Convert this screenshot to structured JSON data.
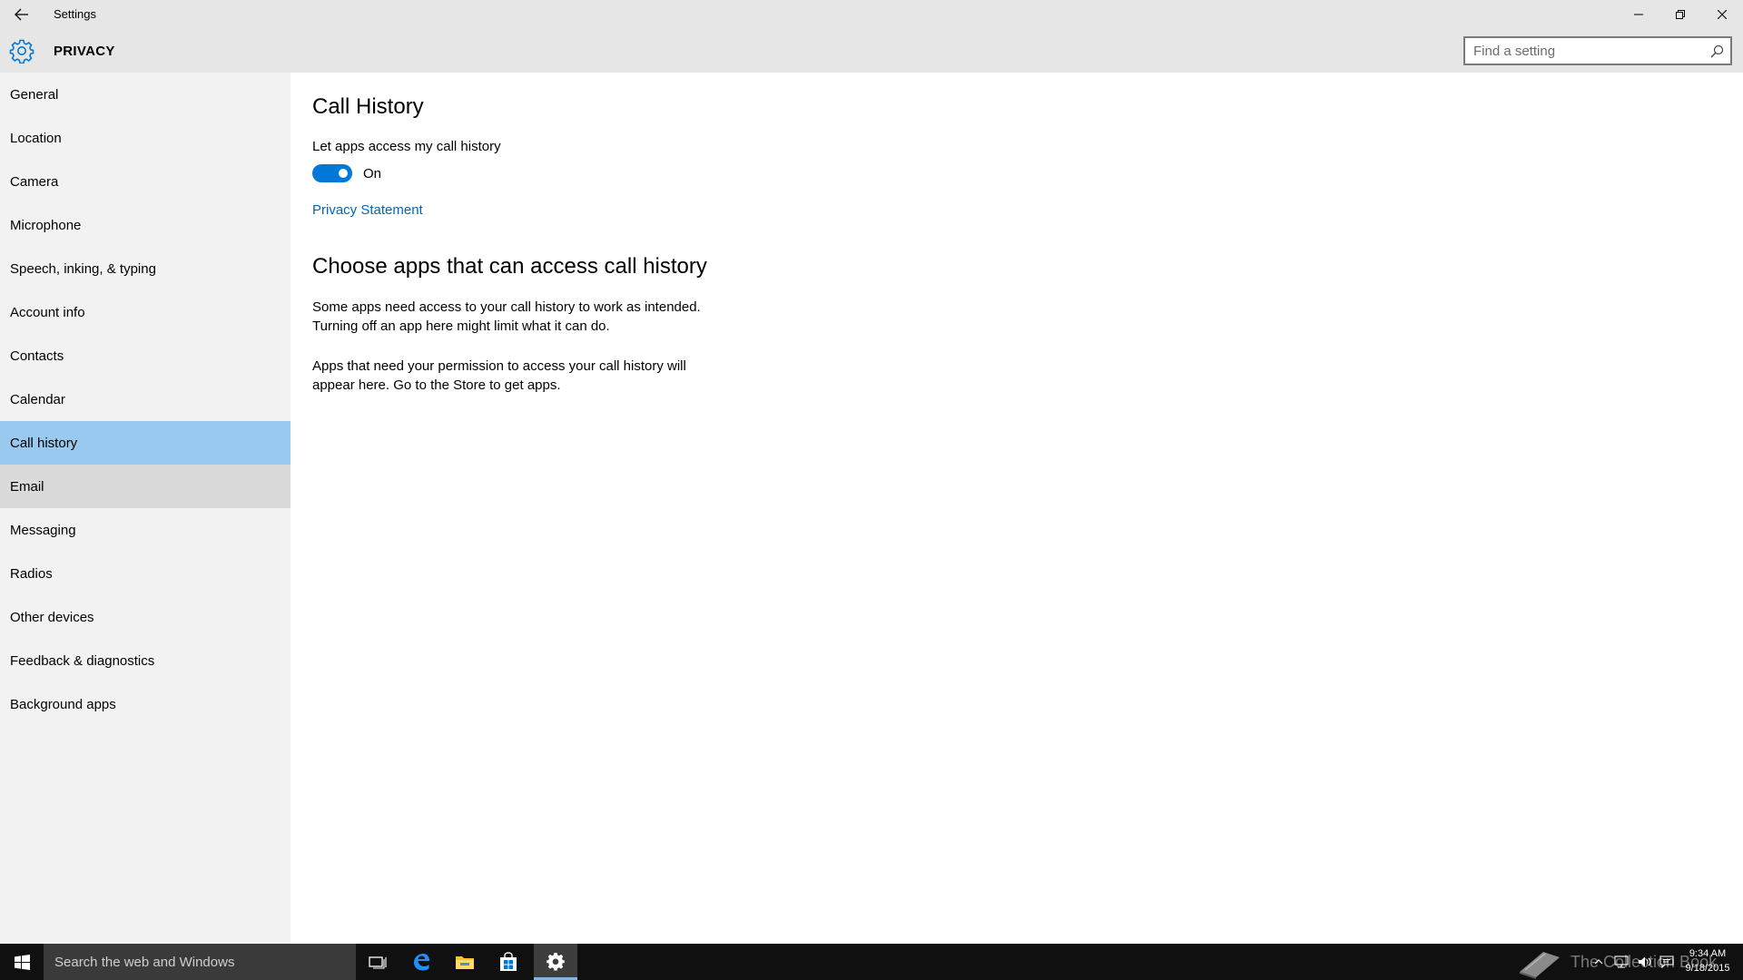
{
  "window": {
    "title": "Settings"
  },
  "header": {
    "section": "PRIVACY",
    "search_placeholder": "Find a setting"
  },
  "sidebar": {
    "items": [
      {
        "label": "General",
        "state": "normal"
      },
      {
        "label": "Location",
        "state": "normal"
      },
      {
        "label": "Camera",
        "state": "normal"
      },
      {
        "label": "Microphone",
        "state": "normal"
      },
      {
        "label": "Speech, inking, & typing",
        "state": "normal"
      },
      {
        "label": "Account info",
        "state": "normal"
      },
      {
        "label": "Contacts",
        "state": "normal"
      },
      {
        "label": "Calendar",
        "state": "normal"
      },
      {
        "label": "Call history",
        "state": "selected"
      },
      {
        "label": "Email",
        "state": "hover"
      },
      {
        "label": "Messaging",
        "state": "normal"
      },
      {
        "label": "Radios",
        "state": "normal"
      },
      {
        "label": "Other devices",
        "state": "normal"
      },
      {
        "label": "Feedback & diagnostics",
        "state": "normal"
      },
      {
        "label": "Background apps",
        "state": "normal"
      }
    ]
  },
  "main": {
    "title": "Call History",
    "toggle_label": "Let apps access my call history",
    "toggle_state": "On",
    "toggle_on": true,
    "privacy_link": "Privacy Statement",
    "choose_title": "Choose apps that can access call history",
    "paragraph1_line1": "Some apps need access to your call history to work as intended.",
    "paragraph1_line2": "Turning off an app here might limit what it can do.",
    "paragraph2_line1": "Apps that need your permission to access your call history will",
    "paragraph2_line2": "appear here. Go to the Store to get apps."
  },
  "taskbar": {
    "search_text": "Search the web and Windows",
    "watermark": "The Collection Book",
    "time": "9:34 AM",
    "date": "9/18/2015",
    "icons": [
      "task-view-icon",
      "edge-icon",
      "file-explorer-icon",
      "store-icon",
      "settings-icon"
    ]
  },
  "colors": {
    "accent": "#0078d7",
    "selected_bg": "#99c9ef",
    "hover_bg": "#dadada",
    "chrome_bg": "#e6e6e6",
    "sidebar_bg": "#f2f2f2",
    "link": "#0067b8",
    "taskbar_bg": "#101010"
  }
}
